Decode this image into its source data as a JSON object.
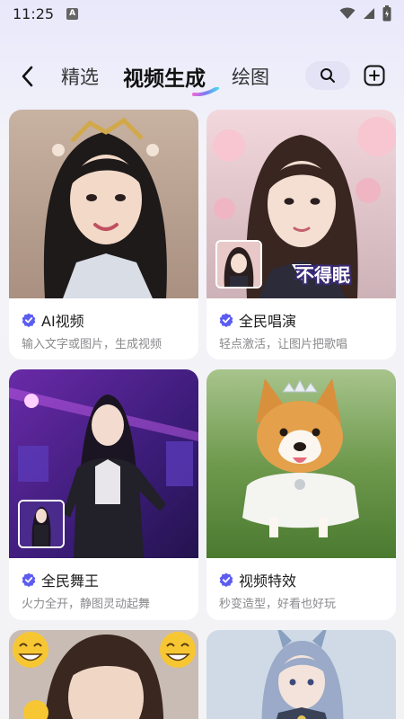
{
  "status": {
    "time": "11:25",
    "notif_letter": "A"
  },
  "nav": {
    "tabs": [
      {
        "label": "精选"
      },
      {
        "label": "视频生成"
      },
      {
        "label": "绘图"
      }
    ]
  },
  "cards": [
    {
      "title": "AI视频",
      "subtitle": "输入文字或图片，生成视频"
    },
    {
      "title": "全民唱演",
      "subtitle": "轻点激活，让图片把歌唱",
      "overlay": "不得眠"
    },
    {
      "title": "全民舞王",
      "subtitle": "火力全开，静图灵动起舞"
    },
    {
      "title": "视频特效",
      "subtitle": "秒变造型，好看也好玩"
    }
  ],
  "colors": {
    "verified": "#5b5cf0",
    "accent": "#1c1c1e"
  }
}
